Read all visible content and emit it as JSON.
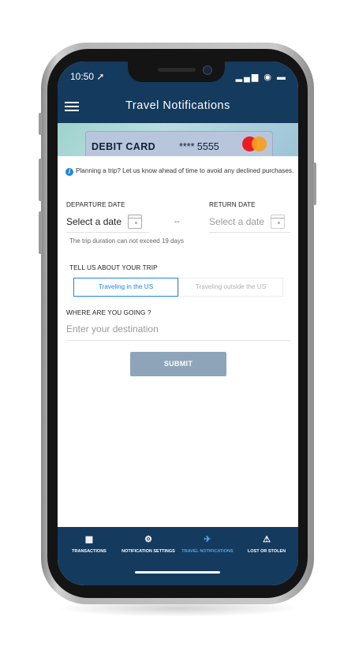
{
  "status_bar": {
    "time": "10:50 ➚",
    "icons": "▂▄▆ ◉ ▬"
  },
  "header": {
    "title": "Travel Notifications"
  },
  "card": {
    "title": "DEBIT CARD",
    "number": "**** 5555"
  },
  "info": {
    "icon": "i",
    "text": "Planning a trip? Let us know ahead of time to avoid any declined purchases."
  },
  "departure": {
    "label": "DEPARTURE DATE",
    "value": "Select a date"
  },
  "separator": "--",
  "return": {
    "label": "RETURN DATE",
    "value": "Select a date"
  },
  "duration_note": "The trip duration can not exceed 19 days",
  "trip": {
    "label": "TELL US ABOUT YOUR TRIP",
    "options": [
      "Traveling in the US",
      "Traveling outside the US"
    ],
    "selected": "Traveling in the US"
  },
  "destination": {
    "label": "WHERE ARE YOU GOING ?",
    "placeholder": "Enter your destination"
  },
  "submit_label": "SUBMIT",
  "nav": [
    {
      "label": "TRANSACTIONS",
      "icon": "transactions-icon",
      "active": false
    },
    {
      "label": "NOTIFICATION SETTINGS",
      "icon": "gear-bell-icon",
      "active": false
    },
    {
      "label": "TRAVEL NOTIFICATIONS",
      "icon": "travel-card-icon",
      "active": true
    },
    {
      "label": "LOST OR STOLEN",
      "icon": "card-alert-icon",
      "active": false
    }
  ],
  "colors": {
    "primary": "#143a5e",
    "accent": "#1e88d6",
    "submit": "#8ea4b9",
    "active_nav": "#4fa8e0"
  }
}
